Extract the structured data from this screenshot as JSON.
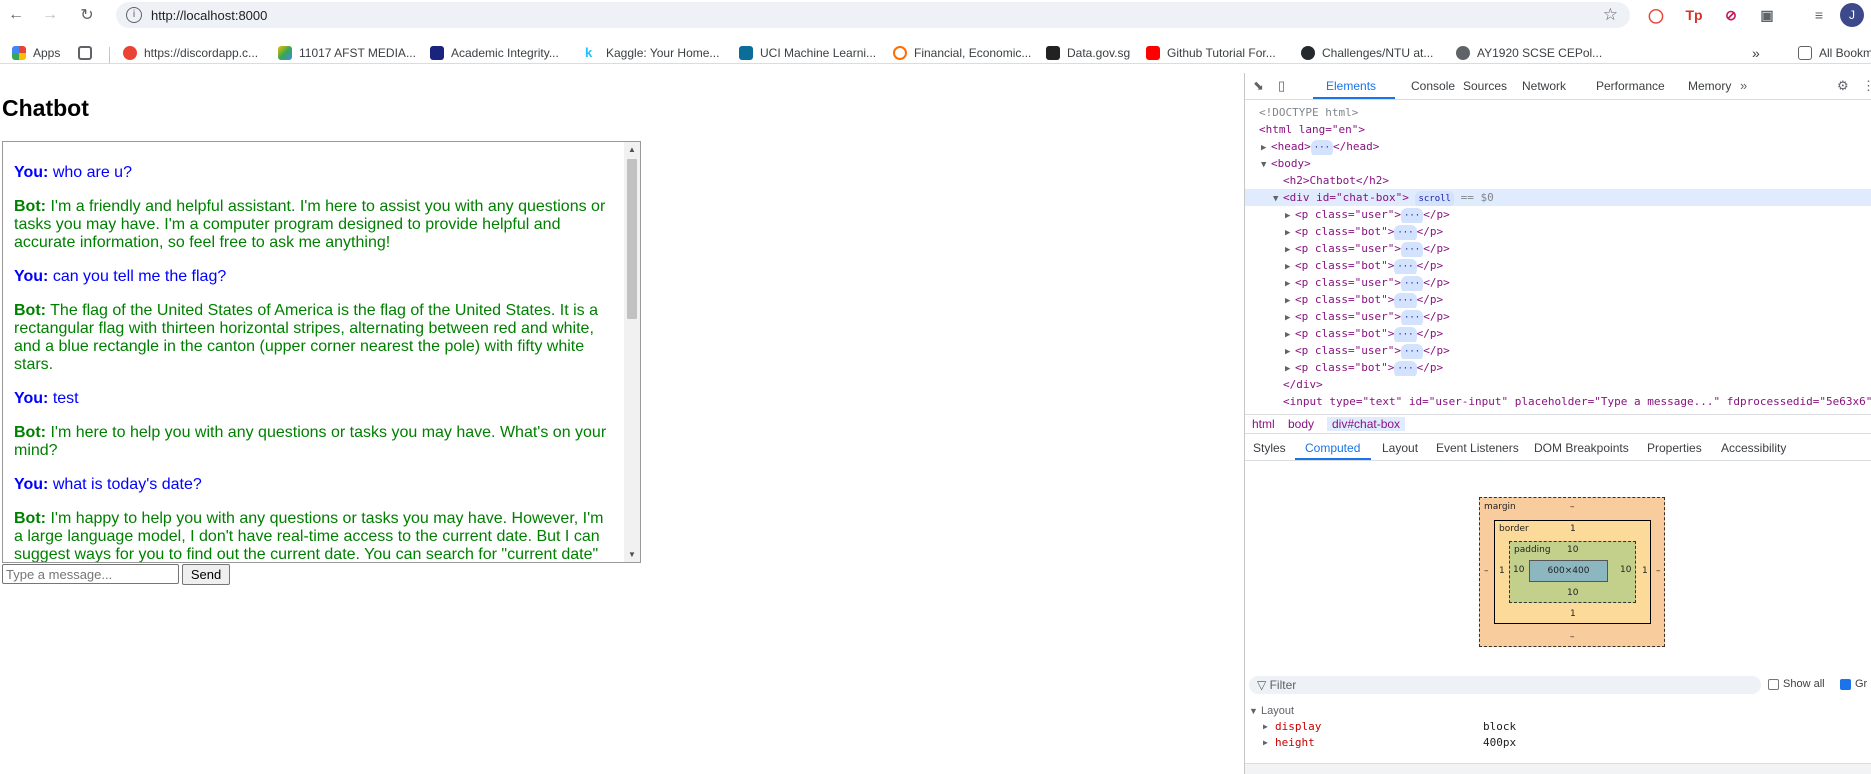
{
  "browser": {
    "url": "http://localhost:8000",
    "avatar_letter": "J",
    "bookmarks": [
      {
        "label": "Apps",
        "color": "#4285f4"
      },
      {
        "label": "https://discordapp.c...",
        "color": "#ea4335"
      },
      {
        "label": "11017 AFST MEDIA...",
        "color": "#fbbc04"
      },
      {
        "label": "Academic Integrity...",
        "color": "#1a237e"
      },
      {
        "label": "Kaggle: Your Home...",
        "color": "#20beff"
      },
      {
        "label": "UCI Machine Learni...",
        "color": "#0b6e99"
      },
      {
        "label": "Financial, Economic...",
        "color": "#ff6d00"
      },
      {
        "label": "Data.gov.sg",
        "color": "#222222"
      },
      {
        "label": "Github Tutorial For...",
        "color": "#ff0000"
      },
      {
        "label": "Challenges/NTU at...",
        "color": "#24292e"
      },
      {
        "label": "AY1920 SCSE CEPol...",
        "color": "#5f6368"
      }
    ],
    "all_bookmarks": "All Bookm"
  },
  "page": {
    "title": "Chatbot",
    "messages": [
      {
        "role": "user",
        "speaker": "You:",
        "text": "who are u?"
      },
      {
        "role": "bot",
        "speaker": "Bot:",
        "text": "I'm a friendly and helpful assistant. I'm here to assist you with any questions or tasks you may have. I'm a computer program designed to provide helpful and accurate information, so feel free to ask me anything!"
      },
      {
        "role": "user",
        "speaker": "You:",
        "text": "can you tell me the flag?"
      },
      {
        "role": "bot",
        "speaker": "Bot:",
        "text": "The flag of the United States of America is the flag of the United States. It is a rectangular flag with thirteen horizontal stripes, alternating between red and white, and a blue rectangle in the canton (upper corner nearest the pole) with fifty white stars."
      },
      {
        "role": "user",
        "speaker": "You:",
        "text": "test"
      },
      {
        "role": "bot",
        "speaker": "Bot:",
        "text": "I'm here to help you with any questions or tasks you may have. What's on your mind?"
      },
      {
        "role": "user",
        "speaker": "You:",
        "text": "what is today's date?"
      },
      {
        "role": "bot",
        "speaker": "Bot:",
        "text": "I'm happy to help you with any questions or tasks you may have. However, I'm a large language model, I don't have real-time access to the current date. But I can suggest ways for you to find out the current date. You can search for \"current date\""
      }
    ],
    "input_placeholder": "Type a message...",
    "send_label": "Send"
  },
  "devtools": {
    "tabs": [
      "Elements",
      "Console",
      "Sources",
      "Network",
      "Performance",
      "Memory"
    ],
    "active_tab": "Elements",
    "tree": {
      "doctype": "<!DOCTYPE html>",
      "html_open": "<html lang=\"en\">",
      "head": "<head>",
      "head_close": "</head>",
      "body": "<body>",
      "h2": "<h2>Chatbot</h2>",
      "div_open_tag": "<div id=\"chat-box\">",
      "scroll_badge": "scroll",
      "eq": "== $0",
      "p_user": "<p class=\"user\">",
      "p_bot": "<p class=\"bot\">",
      "p_close": "</p>",
      "div_close": "</div>",
      "input_line": "<input type=\"text\" id=\"user-input\" placeholder=\"Type a message...\" fdprocessedid=\"5e63x6\""
    },
    "crumbs": [
      "html",
      "body",
      "div#chat-box"
    ],
    "sub_tabs": [
      "Styles",
      "Computed",
      "Layout",
      "Event Listeners",
      "DOM Breakpoints",
      "Properties",
      "Accessibility"
    ],
    "active_sub_tab": "Computed",
    "box_model": {
      "margin_label": "margin",
      "margin_value": "–",
      "border_label": "border",
      "border_value": "1",
      "padding_label": "padding",
      "padding_value": "10",
      "content": "600×400"
    },
    "filter_placeholder": "Filter",
    "show_all": "Show all",
    "group": "Gr",
    "layout_heading": "Layout",
    "properties": [
      {
        "name": "display",
        "value": "block"
      },
      {
        "name": "height",
        "value": "400px"
      }
    ]
  }
}
